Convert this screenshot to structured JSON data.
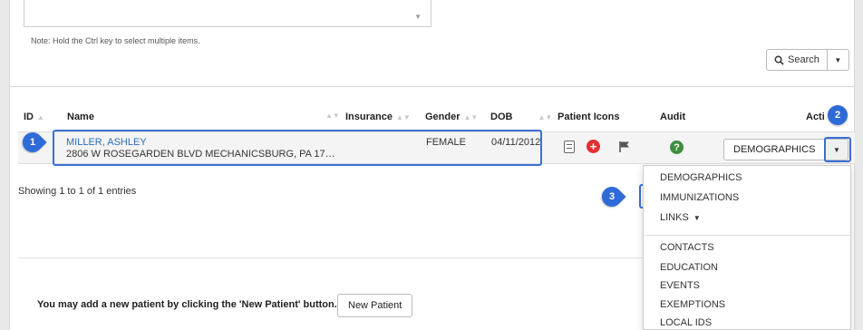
{
  "filter": {
    "note": "Note: Hold the Ctrl key to select multiple items.",
    "search_label": "Search"
  },
  "table": {
    "columns": [
      "ID",
      "Name",
      "Insurance",
      "Gender",
      "DOB",
      "Patient Icons",
      "Audit",
      "Acti"
    ],
    "rows": [
      {
        "name": "MILLER, ASHLEY",
        "address": "2806 W ROSEGARDEN BLVD MECHANICSBURG, PA 17…",
        "gender": "FEMALE",
        "dob": "04/11/2012",
        "action": "DEMOGRAPHICS"
      }
    ],
    "info": "Showing 1 to 1 of 1 entries"
  },
  "callouts": [
    "1",
    "2",
    "3"
  ],
  "dropdown": {
    "items": [
      "DEMOGRAPHICS",
      "IMMUNIZATIONS",
      "LINKS",
      "CONTACTS",
      "EDUCATION",
      "EVENTS",
      "EXEMPTIONS",
      "LOCAL IDS"
    ]
  },
  "footer": {
    "text": "You may add a new patient by clicking the 'New Patient' button.",
    "new_patient_label": "New Patient"
  },
  "colors": {
    "accent": "#2f6ad9",
    "link": "#2a6ebb",
    "danger": "#e03131",
    "success": "#3e8e3e"
  }
}
